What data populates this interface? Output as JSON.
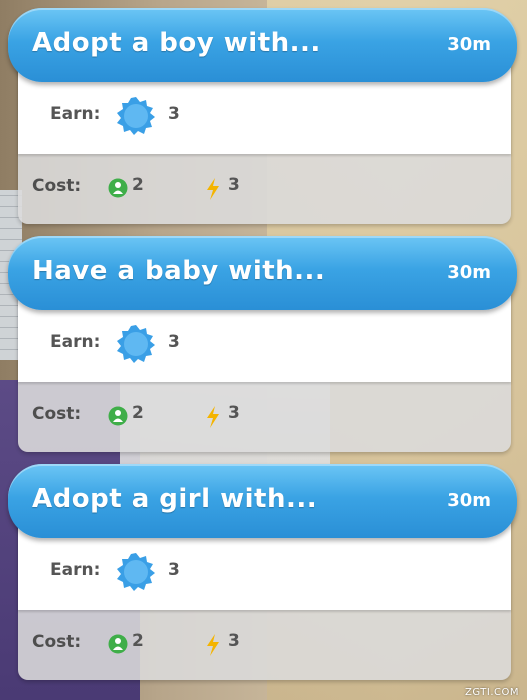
{
  "tasks": [
    {
      "title": "Adopt a boy with...",
      "time": "30m",
      "earn_label": "Earn:",
      "earn_value": "3",
      "cost_label": "Cost:",
      "cost_people": "2",
      "cost_energy": "3"
    },
    {
      "title": "Have a baby with...",
      "time": "30m",
      "earn_label": "Earn:",
      "earn_value": "3",
      "cost_label": "Cost:",
      "cost_people": "2",
      "cost_energy": "3"
    },
    {
      "title": "Adopt a girl with...",
      "time": "30m",
      "earn_label": "Earn:",
      "earn_value": "3",
      "cost_label": "Cost:",
      "cost_people": "2",
      "cost_energy": "3"
    }
  ],
  "icons": {
    "earn": "blue-badge-icon",
    "people": "green-person-icon",
    "energy": "lightning-icon"
  },
  "colors": {
    "header_blue": "#3aa3e4",
    "badge_blue": "#3a9fe6",
    "person_green": "#3fae49",
    "energy_yellow": "#f4b400"
  },
  "watermark": "ZGTI.COM"
}
